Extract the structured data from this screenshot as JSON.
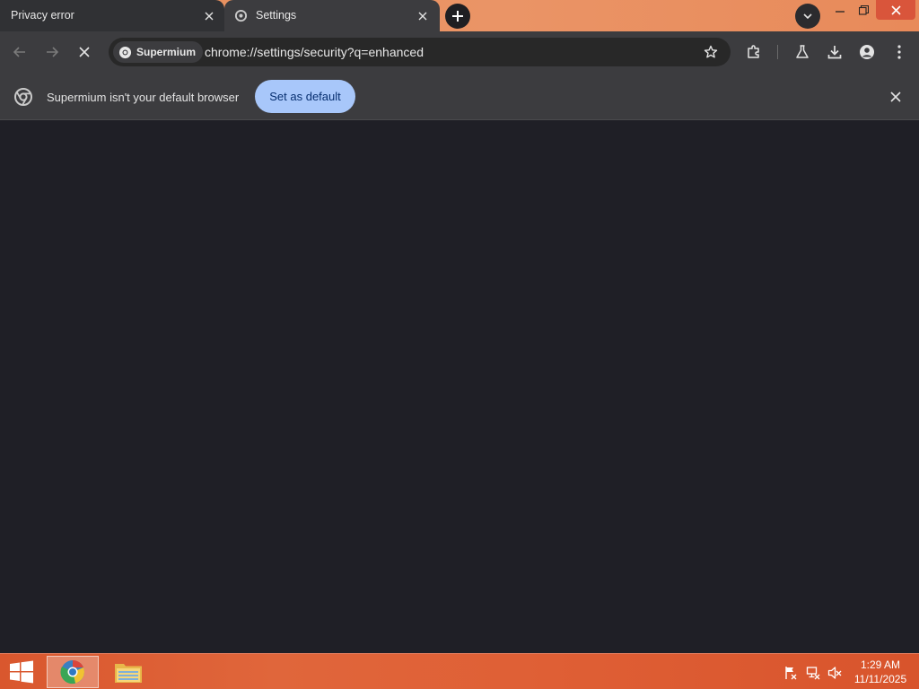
{
  "tabs": [
    {
      "title": "Privacy error",
      "active": false
    },
    {
      "title": "Settings",
      "active": true
    }
  ],
  "toolbar": {
    "site_chip": "Supermium",
    "url": "chrome://settings/security?q=enhanced"
  },
  "infobar": {
    "message": "Supermium isn't your default browser",
    "button_label": "Set as default"
  },
  "taskbar": {
    "apps": [
      "browser-icon",
      "file-explorer-icon"
    ],
    "tray_icons": [
      "action-center-flag-icon",
      "network-icon",
      "volume-muted-icon"
    ],
    "time": "1:29 AM",
    "date": "11/11/2025"
  },
  "colors": {
    "tabstrip": "#e78f5c",
    "toolbar": "#3c3c3f",
    "content": "#1f1f26",
    "accent_button": "#a8c7fa",
    "taskbar": "#d9572e",
    "close_button": "#d9553b"
  }
}
